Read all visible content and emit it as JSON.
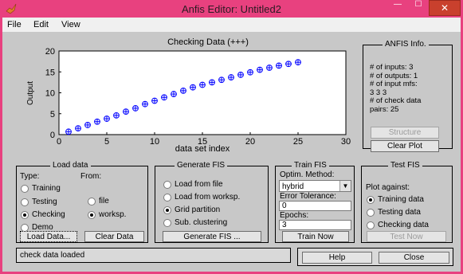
{
  "window": {
    "title": "Anfis Editor: Untitled2",
    "minimize_glyph": "—",
    "maximize_glyph": "☐",
    "close_glyph": "✕"
  },
  "menu": [
    "File",
    "Edit",
    "View"
  ],
  "colors": {
    "titlebar": "#e8417f",
    "close_button": "#c9402d",
    "panel": "#c8c8c8",
    "plot_marker": "#0000ff"
  },
  "chart_data": {
    "type": "scatter",
    "title": "Checking Data (+++)",
    "xlabel": "data set index",
    "ylabel": "Output",
    "xlim": [
      0,
      30
    ],
    "ylim": [
      0,
      20
    ],
    "xticks": [
      0,
      5,
      10,
      15,
      20,
      25,
      30
    ],
    "yticks": [
      0,
      5,
      10,
      15,
      20
    ],
    "marker": "circle-plus",
    "series": [
      {
        "x": [
          1,
          2,
          3,
          4,
          5,
          6,
          7,
          8,
          9,
          10,
          11,
          12,
          13,
          14,
          15,
          16,
          17,
          18,
          19,
          20,
          21,
          22,
          23,
          24,
          25
        ],
        "y": [
          0.7,
          1.5,
          2.3,
          3.1,
          3.8,
          4.6,
          5.5,
          6.3,
          7.3,
          8.1,
          8.9,
          9.7,
          10.5,
          11.3,
          11.9,
          12.5,
          13.1,
          13.7,
          14.3,
          14.9,
          15.5,
          16.0,
          16.5,
          16.9,
          17.3
        ]
      }
    ]
  },
  "anfis_info": {
    "title": "ANFIS Info.",
    "lines": [
      "# of inputs: 3",
      "# of outputs: 1",
      "# of input mfs:",
      "3  3  3",
      "# of check data",
      "pairs: 25"
    ],
    "structure_button": "Structure",
    "clear_plot_button": "Clear Plot"
  },
  "load_data": {
    "title": "Load data",
    "type_label": "Type:",
    "from_label": "From:",
    "types": [
      {
        "label": "Training",
        "selected": false
      },
      {
        "label": "Testing",
        "selected": false
      },
      {
        "label": "Checking",
        "selected": true
      },
      {
        "label": "Demo",
        "selected": false
      }
    ],
    "sources": [
      {
        "label": "file",
        "selected": false
      },
      {
        "label": "worksp.",
        "selected": true
      }
    ],
    "load_button": "Load Data...",
    "clear_button": "Clear Data"
  },
  "generate_fis": {
    "title": "Generate FIS",
    "options": [
      {
        "label": "Load from file",
        "selected": false
      },
      {
        "label": "Load from worksp.",
        "selected": false
      },
      {
        "label": "Grid partition",
        "selected": true
      },
      {
        "label": "Sub. clustering",
        "selected": false
      }
    ],
    "button": "Generate FIS ..."
  },
  "train_fis": {
    "title": "Train FIS",
    "method_label": "Optim. Method:",
    "method_value": "hybrid",
    "tolerance_label": "Error Tolerance:",
    "tolerance_value": "0",
    "epochs_label": "Epochs:",
    "epochs_value": "3",
    "button": "Train Now"
  },
  "test_fis": {
    "title": "Test FIS",
    "plot_against_label": "Plot against:",
    "options": [
      {
        "label": "Training data",
        "selected": true
      },
      {
        "label": "Testing data",
        "selected": false
      },
      {
        "label": "Checking data",
        "selected": false
      }
    ],
    "button": "Test Now"
  },
  "status": {
    "message": "check data loaded",
    "help_button": "Help",
    "close_button": "Close"
  }
}
